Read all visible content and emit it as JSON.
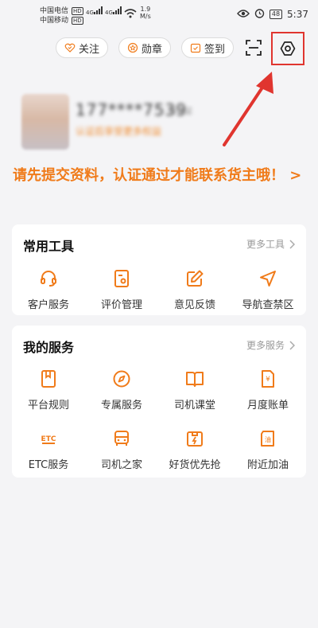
{
  "status_bar": {
    "carrier1": "中国电信",
    "carrier2": "中国移动",
    "hd": "HD",
    "sig1": "4G",
    "sig2": "4G",
    "speed_value": "1.9",
    "speed_unit": "M/s",
    "battery": "48",
    "time": "5:37"
  },
  "header": {
    "follow_label": "关注",
    "medal_label": "勋章",
    "checkin_label": "签到"
  },
  "profile": {
    "name_masked": "177****7539",
    "tag_blurred": "未认证",
    "subtitle_blurred": "认证后享受更多权益"
  },
  "notice": "请先提交资料，认证通过才能联系货主哦！ >",
  "tools": {
    "title": "常用工具",
    "more": "更多工具",
    "items": [
      {
        "label": "客户服务",
        "icon": "headset-icon"
      },
      {
        "label": "评价管理",
        "icon": "evaluation-icon"
      },
      {
        "label": "意见反馈",
        "icon": "feedback-icon"
      },
      {
        "label": "导航查禁区",
        "icon": "navigation-icon"
      }
    ]
  },
  "services": {
    "title": "我的服务",
    "more": "更多服务",
    "items": [
      {
        "label": "平台规则",
        "icon": "rules-icon"
      },
      {
        "label": "专属服务",
        "icon": "compass-icon"
      },
      {
        "label": "司机课堂",
        "icon": "book-icon"
      },
      {
        "label": "月度账单",
        "icon": "bill-icon"
      },
      {
        "label": "ETC服务",
        "icon": "etc-icon"
      },
      {
        "label": "司机之家",
        "icon": "truck-icon"
      },
      {
        "label": "好货优先抢",
        "icon": "package-icon"
      },
      {
        "label": "附近加油",
        "icon": "fuel-icon"
      }
    ]
  },
  "colors": {
    "accent": "#f07b1a",
    "highlight": "#e0352f"
  }
}
